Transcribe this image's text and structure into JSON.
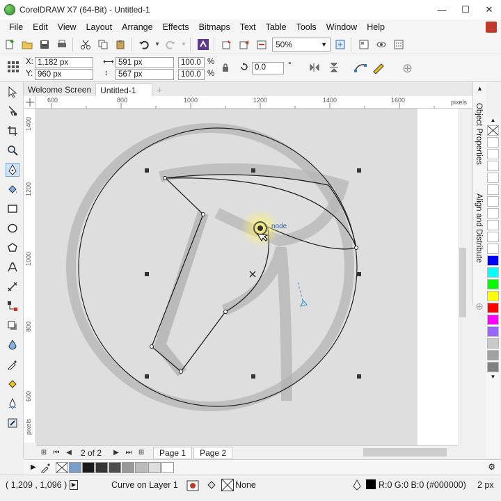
{
  "window": {
    "title": "CorelDRAW X7 (64-Bit) - Untitled-1",
    "controls": {
      "minimize": "—",
      "maximize": "☐",
      "close": "✕"
    }
  },
  "menu": [
    "File",
    "Edit",
    "View",
    "Layout",
    "Arrange",
    "Effects",
    "Bitmaps",
    "Text",
    "Table",
    "Tools",
    "Window",
    "Help"
  ],
  "toolbar": {
    "zoom": "50%"
  },
  "properties": {
    "x_label": "X:",
    "x_value": "1,182 px",
    "y_label": "Y:",
    "y_value": "960 px",
    "width_value": "591 px",
    "height_value": "567 px",
    "scale_w": "100.0",
    "scale_h": "100.0",
    "percent": "%",
    "rotation": "0.0",
    "degree": "°"
  },
  "document_tabs": [
    "Welcome Screen",
    "Untitled-1"
  ],
  "ruler": {
    "top_labels": [
      "600",
      "800",
      "1000",
      "1200",
      "1400",
      "1600"
    ],
    "top_unit": "pixels",
    "left_labels": [
      "1400",
      "1200",
      "1000",
      "800",
      "600"
    ],
    "left_unit": "pixels"
  },
  "canvas": {
    "node_tooltip": "node"
  },
  "dockers": [
    "Object Properties",
    "Align and Distribute"
  ],
  "palette": {
    "colors": [
      "#ffffff",
      "#000000",
      "#0000ff",
      "#00ffff",
      "#00ff00",
      "#ffff00",
      "#ff0000",
      "#ff00ff",
      "#9966ff",
      "#c8c8c8",
      "#a0a0a0",
      "#808080"
    ]
  },
  "page_nav": {
    "counter": "2 of 2",
    "pages": [
      "Page 1",
      "Page 2"
    ]
  },
  "doc_palette": {
    "colors": [
      "#7b9ec9",
      "#1a1a1a",
      "#333333",
      "#4d4d4d",
      "#999999",
      "#bbbbbb",
      "#dddddd",
      "#ffffff"
    ]
  },
  "status": {
    "coords": "( 1,209 , 1,096 )",
    "object": "Curve on Layer 1",
    "fill": "None",
    "outline": "R:0 G:0 B:0 (#000000)",
    "outline_width": "2 px"
  }
}
